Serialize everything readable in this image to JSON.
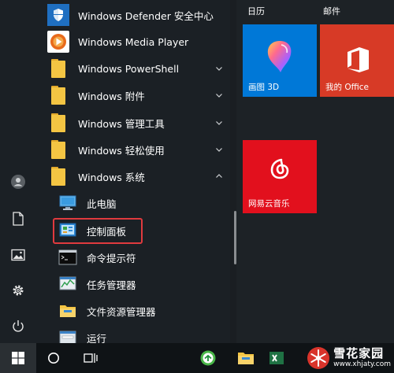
{
  "rail": {
    "items": [
      {
        "icon": "user-avatar-icon"
      },
      {
        "icon": "document-icon"
      },
      {
        "icon": "pictures-icon"
      },
      {
        "icon": "settings-gear-icon"
      },
      {
        "icon": "power-icon"
      }
    ]
  },
  "apps": [
    {
      "label": "Windows Defender 安全中心",
      "icon": "shield-icon",
      "color": "#1f6fc1"
    },
    {
      "label": "Windows Media Player",
      "icon": "media-player-icon",
      "color": "#e86a1b"
    },
    {
      "label": "Windows PowerShell",
      "icon": "folder-icon",
      "expand": "collapsed"
    },
    {
      "label": "Windows 附件",
      "icon": "folder-icon",
      "expand": "collapsed"
    },
    {
      "label": "Windows 管理工具",
      "icon": "folder-icon",
      "expand": "collapsed"
    },
    {
      "label": "Windows 轻松使用",
      "icon": "folder-icon",
      "expand": "collapsed"
    },
    {
      "label": "Windows 系统",
      "icon": "folder-icon",
      "expand": "expanded"
    }
  ],
  "sub_apps": [
    {
      "label": "此电脑",
      "icon": "this-pc-icon"
    },
    {
      "label": "控制面板",
      "icon": "control-panel-icon",
      "highlighted": true
    },
    {
      "label": "命令提示符",
      "icon": "command-prompt-icon"
    },
    {
      "label": "任务管理器",
      "icon": "task-manager-icon"
    },
    {
      "label": "文件资源管理器",
      "icon": "file-explorer-icon"
    },
    {
      "label": "运行",
      "icon": "run-icon"
    }
  ],
  "tile_groups": {
    "group1": "日历",
    "group2": "邮件"
  },
  "tiles": {
    "paint3d": {
      "label": "画图 3D",
      "color": "#0078d7"
    },
    "office": {
      "label": "我的 Office",
      "color": "#d73a26"
    },
    "netease": {
      "label": "网易云音乐",
      "color": "#e2101d"
    }
  },
  "taskbar": {
    "items": [
      "windows-start-icon",
      "cortana-circle-icon",
      "task-view-icon",
      "browser-icon",
      "file-explorer-icon",
      "excel-icon"
    ]
  },
  "watermark": {
    "title": "雪花家园",
    "url": "www.xhjaty.com"
  },
  "colors": {
    "highlight": "#e03a3e",
    "folder": "#f4c543",
    "tile_blue": "#0078d7"
  }
}
